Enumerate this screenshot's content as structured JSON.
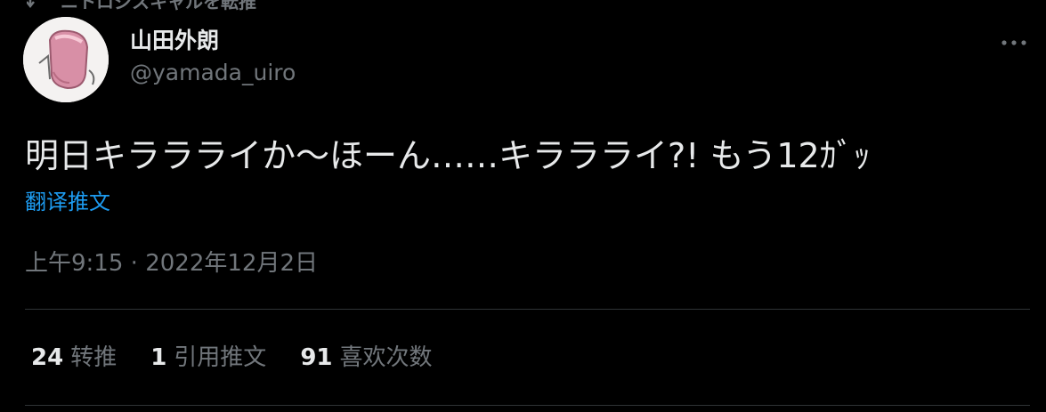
{
  "retweet_context": {
    "label": "ニトロジスキャルを転推",
    "icon": "retweet-icon"
  },
  "author": {
    "display_name": "山田外朗",
    "handle": "@yamada_uiro",
    "avatar_icon": "avatar"
  },
  "more_icon": "more-icon",
  "tweet": {
    "text": "明日キララライか〜ほーん……キララライ?! もう12ｶﾞｯ",
    "translate_label": "翻译推文",
    "time": "上午9:15",
    "separator": "·",
    "date": "2022年12月2日"
  },
  "stats": {
    "retweets": {
      "count": "24",
      "label": "转推"
    },
    "quotes": {
      "count": "1",
      "label": "引用推文"
    },
    "likes": {
      "count": "91",
      "label": "喜欢次数"
    }
  },
  "colors": {
    "background": "#000000",
    "text": "#e7e9ea",
    "muted": "#71767b",
    "link": "#1d9bf0",
    "divider": "#2f3336"
  }
}
